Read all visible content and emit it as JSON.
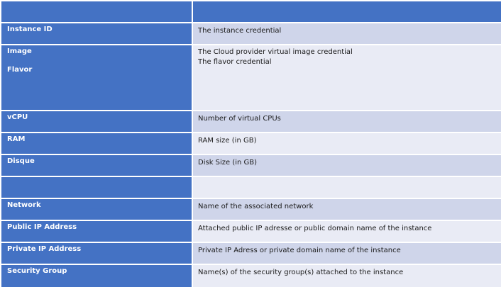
{
  "table": {
    "rows": [
      {
        "label": "Instance ID",
        "desc": "The instance credential"
      },
      {
        "label": "Image",
        "label2": "Flavor",
        "desc": "The Cloud provider virtual image credential",
        "desc2": "The flavor credential"
      },
      {
        "label": "vCPU",
        "desc": "Number of virtual CPUs"
      },
      {
        "label": "RAM",
        "desc": "RAM size (in GB)"
      },
      {
        "label": "Disque",
        "desc": "Disk Size (in GB)"
      },
      {
        "label": "",
        "desc": ""
      },
      {
        "label": "Network",
        "desc": "Name of the associated network"
      },
      {
        "label": "Public IP Address",
        "desc": "Attached public IP adresse or public domain name of the instance"
      },
      {
        "label": "Private IP Address",
        "desc": "Private IP Adress or private domain name of the instance"
      },
      {
        "label": "Security Group",
        "desc": "Name(s) of the security group(s) attached to the instance"
      }
    ]
  }
}
